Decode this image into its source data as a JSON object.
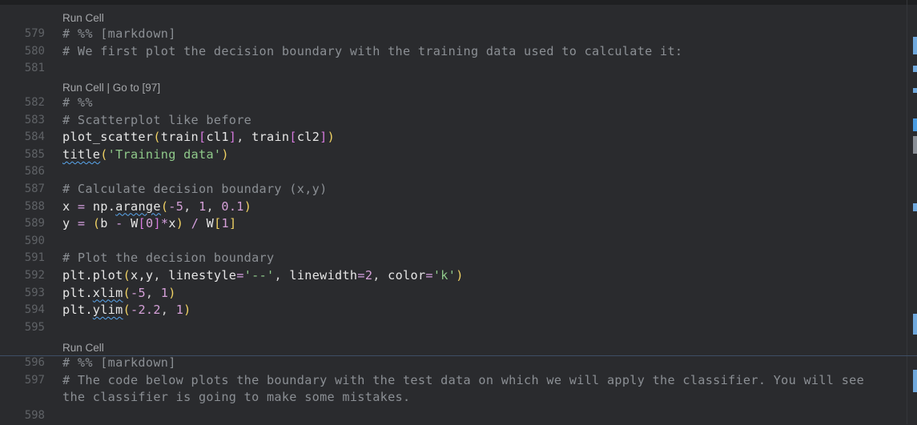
{
  "editor": {
    "codelens": {
      "cell1": "Run Cell",
      "cell2": "Run Cell | Go to [97]",
      "cell3": "Run Cell"
    },
    "line_numbers": {
      "l579": "579",
      "l580": "580",
      "l581": "581",
      "l582": "582",
      "l583": "583",
      "l584": "584",
      "l585": "585",
      "l586": "586",
      "l587": "587",
      "l588": "588",
      "l589": "589",
      "l590": "590",
      "l591": "591",
      "l592": "592",
      "l593": "593",
      "l594": "594",
      "l595": "595",
      "l596": "596",
      "l597": "597",
      "l598": "598"
    },
    "code": {
      "l579": "# %% [markdown]",
      "l580": "# We first plot the decision boundary with the training data used to calculate it:",
      "l582": "# %%",
      "l583": "# Scatterplot like before",
      "l584_fn": "plot_scatter",
      "l584_args1": "train",
      "l584_idx1": "cl1",
      "l584_args2": "train",
      "l584_idx2": "cl2",
      "l585_fn": "title",
      "l585_str": "'Training data'",
      "l587": "# Calculate decision boundary (x,y)",
      "l588_var": "x",
      "l588_mod": "np.",
      "l588_fn": "arange",
      "l588_a": "-5",
      "l588_b": "1",
      "l588_c": "0.1",
      "l589_var": "y",
      "l589_b": "b",
      "l589_w0": "W",
      "l589_i0": "0",
      "l589_x": "x",
      "l589_w1": "W",
      "l589_i1": "1",
      "l591": "# Plot the decision boundary",
      "l592_fn": "plt.plot",
      "l592_xy": "x,y",
      "l592_ls": "linestyle",
      "l592_lsv": "'--'",
      "l592_lw": "linewidth",
      "l592_lwv": "2",
      "l592_c": "color",
      "l592_cv": "'k'",
      "l593_mod": "plt.",
      "l593_fn": "xlim",
      "l593_a": "-5",
      "l593_b": "1",
      "l594_mod": "plt.",
      "l594_fn": "ylim",
      "l594_a": "-2.2",
      "l594_b": "1",
      "l596": "# %% [markdown]",
      "l597a": "# The code below plots the boundary with the test data on which we will apply the classifier. You will see",
      "l597b": "the classifier is going to make some mistakes."
    }
  },
  "colors": {
    "background": "#2a2b2e",
    "comment": "#8b8f94",
    "string": "#8fc98a",
    "number": "#d5a0d8",
    "bracket_level1": "#f0d264",
    "bracket_level2": "#d77adf",
    "bracket_level3": "#5aa8f0",
    "cell_border": "#3e4f66"
  }
}
